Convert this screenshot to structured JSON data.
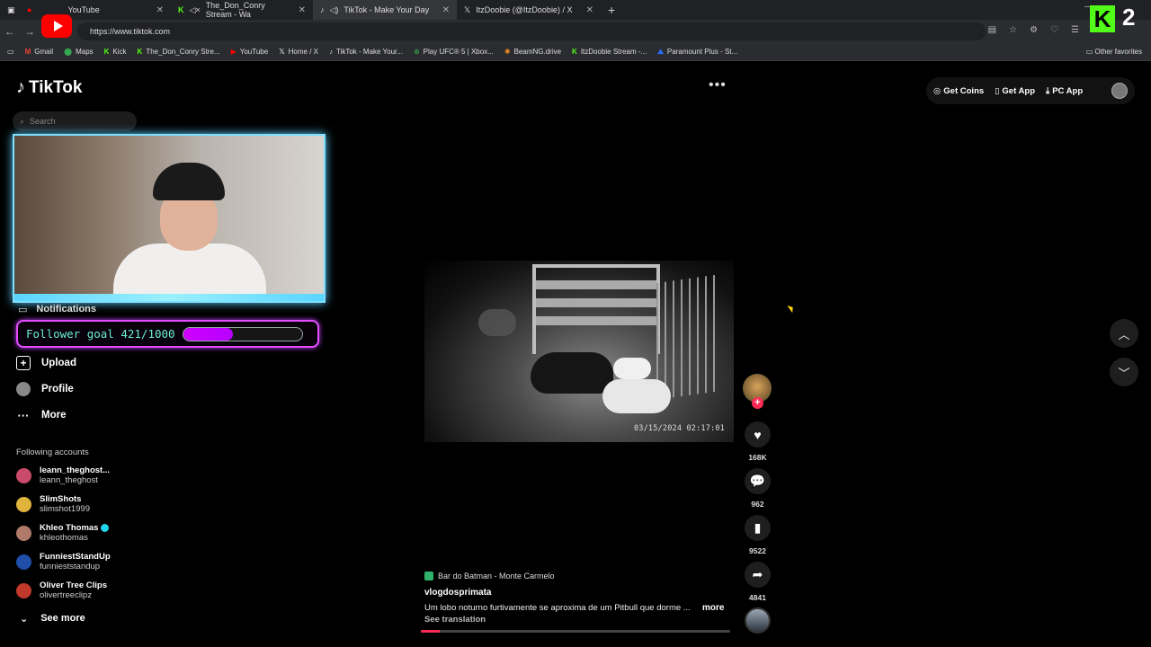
{
  "browser": {
    "tabs": [
      {
        "label": "YouTube",
        "icon": "youtube-icon",
        "active": false
      },
      {
        "label": "The_Don_Conry Stream - Wa",
        "icon": "kick-icon",
        "active": false
      },
      {
        "label": "TikTok - Make Your Day",
        "icon": "tiktok-icon",
        "active": true
      },
      {
        "label": "ItzDoobie (@ItzDoobie) / X",
        "icon": "x-icon",
        "active": false
      }
    ],
    "url": "https://www.tiktok.com",
    "bookmarks": [
      "Gmail",
      "Maps",
      "Kick",
      "The_Don_Conry Stre...",
      "YouTube",
      "Home / X",
      "TikTok - Make Your...",
      "Play UFC® 5 | Xbox...",
      "BeamNG.drive",
      "ItzDoobie Stream -...",
      "Paramount Plus - St..."
    ],
    "other_favorites": "Other favorites"
  },
  "overlay": {
    "kick_count": "2",
    "follower_goal_text": "Follower goal 421/1000",
    "follower_goal_fraction": 0.421
  },
  "header": {
    "logo": "TikTok",
    "search_placeholder": "Search",
    "get_coins": "Get Coins",
    "get_app": "Get App",
    "pc_app": "PC App"
  },
  "sidebar": {
    "notifications": "Notifications",
    "upload": "Upload",
    "profile": "Profile",
    "more": "More",
    "following_title": "Following accounts",
    "accounts": [
      {
        "name": "leann_theghost...",
        "handle": "leann_theghost",
        "color": "#c94a6a",
        "verified": false
      },
      {
        "name": "SlimShots",
        "handle": "slimshot1999",
        "color": "#e0b43c",
        "verified": false
      },
      {
        "name": "Khleo Thomas",
        "handle": "khleothomas",
        "color": "#b07a6a",
        "verified": true
      },
      {
        "name": "FunniestStandUp",
        "handle": "funnieststandup",
        "color": "#1f4fa8",
        "verified": false
      },
      {
        "name": "Oliver Tree Clips",
        "handle": "olivertreeclipz",
        "color": "#c0392b",
        "verified": false
      }
    ],
    "see_more": "See more"
  },
  "video": {
    "timestamp": "03/15/2024 02:17:01",
    "likes": "168K",
    "comments": "962",
    "saves": "9522",
    "shares": "4841",
    "location": "Bar do Batman - Monte Carmelo",
    "uploader": "vlogdosprimata",
    "description": "Um lobo noturno furtivamente se aproxima de um Pitbull que dorme ...",
    "more": "more",
    "see_translation": "See translation",
    "progress_fraction": 0.06
  }
}
